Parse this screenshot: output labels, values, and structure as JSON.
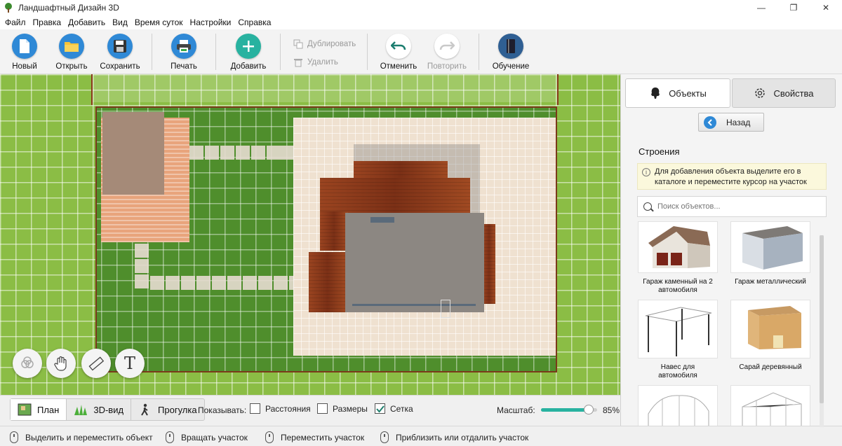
{
  "window": {
    "title": "Ландшафтный Дизайн 3D",
    "controls": {
      "minimize": "—",
      "maximize": "❐",
      "close": "✕"
    }
  },
  "menu": [
    "Файл",
    "Правка",
    "Добавить",
    "Вид",
    "Время суток",
    "Настройки",
    "Справка"
  ],
  "toolbar": {
    "new": "Новый",
    "open": "Открыть",
    "save": "Сохранить",
    "print": "Печать",
    "add": "Добавить",
    "duplicate": "Дублировать",
    "delete": "Удалить",
    "undo": "Отменить",
    "redo": "Повторить",
    "tutorial": "Обучение"
  },
  "canvas_tools": {
    "text_tool_glyph": "T"
  },
  "view_tabs": [
    "План",
    "3D-вид",
    "Прогулка"
  ],
  "display": {
    "label": "Показывать:",
    "options": [
      {
        "label": "Расстояния",
        "checked": false
      },
      {
        "label": "Размеры",
        "checked": false
      },
      {
        "label": "Сетка",
        "checked": true
      }
    ]
  },
  "zoom": {
    "label": "Масштаб:",
    "value_text": "85%",
    "value": 0.85
  },
  "status_hints": [
    "Выделить и переместить объект",
    "Вращать участок",
    "Переместить участок",
    "Приблизить или отдалить участок"
  ],
  "panel": {
    "tabs": {
      "objects": "Объекты",
      "properties": "Свойства"
    },
    "back": "Назад",
    "section": "Строения",
    "info": "Для добавления объекта выделите его в каталоге и переместите курсор на участок",
    "search_placeholder": "Поиск объектов...",
    "items": [
      {
        "name": "Гараж каменный на 2 автомобиля"
      },
      {
        "name": "Гараж металлический"
      },
      {
        "name": "Навес для автомобиля"
      },
      {
        "name": "Сарай деревянный"
      },
      {
        "name": ""
      },
      {
        "name": ""
      }
    ]
  },
  "colors": {
    "accent_teal": "#28b2a0",
    "lawn_dark": "#4f8e2c",
    "lawn_light": "#8bbd45",
    "back_blue": "#2f89d6"
  }
}
